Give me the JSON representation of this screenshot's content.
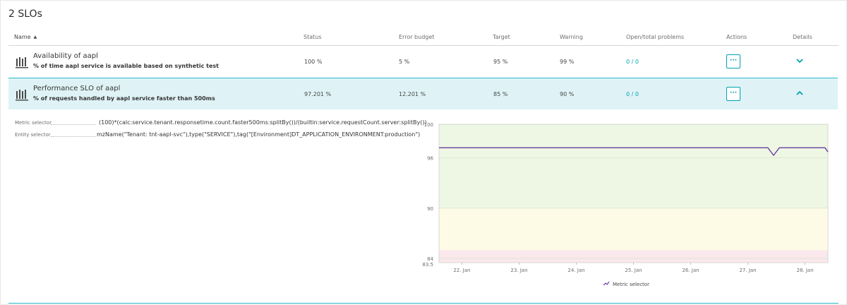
{
  "page": {
    "title": "2 SLOs"
  },
  "table": {
    "headers": {
      "name": "Name",
      "status": "Status",
      "error_budget": "Error budget",
      "target": "Target",
      "warning": "Warning",
      "problems": "Open/total problems",
      "actions": "Actions",
      "details": "Details"
    },
    "sort_icon": "sort-ascending-icon",
    "rows": [
      {
        "name": "Availability of aapl",
        "description": "% of time aapl service is available based on synthetic test",
        "status": "100 %",
        "error_budget": "5 %",
        "target": "95 %",
        "warning": "99 %",
        "problems": "0 / 0",
        "actions_label": "···",
        "expanded": false
      },
      {
        "name": "Performance SLO of aapl",
        "description": "% of requests handled by aapl service faster than 500ms",
        "status": "97.201 %",
        "error_budget": "12.201 %",
        "target": "85 %",
        "warning": "90 %",
        "problems": "0 / 0",
        "actions_label": "···",
        "expanded": true
      }
    ]
  },
  "details": {
    "metric_selector_label": "Metric selector",
    "metric_selector_value": "(100)*(calc:service.tenant.responsetime.count.faster500ms:splitBy())/(builtin:service.requestCount.server:splitBy())",
    "entity_selector_label": "Entity selector",
    "entity_selector_value": "mzName(\"Tenant: tnt-aapl-svc\"),type(\"SERVICE\"),tag(\"[Environment]DT_APPLICATION_ENVIRONMENT:production\")"
  },
  "colors": {
    "accent": "#00a1b2",
    "selected_row": "#dff3f6",
    "line": "#6b3fa0",
    "zone_good": "#eef6e4",
    "zone_warning": "#fdfbe5",
    "zone_bad": "#fbe8ec"
  },
  "chart_data": {
    "type": "line",
    "title": "",
    "xlabel": "",
    "ylabel": "",
    "xlim": [
      21.6,
      28.4
    ],
    "ylim": [
      83.5,
      100
    ],
    "y_ticks": [
      {
        "value": 100,
        "label": "100"
      },
      {
        "value": 96,
        "label": "96"
      },
      {
        "value": 90,
        "label": "90"
      },
      {
        "value": 84,
        "label": "84"
      },
      {
        "value": 83.5,
        "label": "83.5"
      }
    ],
    "x_ticks": [
      {
        "value": 22,
        "label": "22. Jan"
      },
      {
        "value": 23,
        "label": "23. Jan"
      },
      {
        "value": 24,
        "label": "24. Jan"
      },
      {
        "value": 25,
        "label": "25. Jan"
      },
      {
        "value": 26,
        "label": "26. Jan"
      },
      {
        "value": 27,
        "label": "27. Jan"
      },
      {
        "value": 28,
        "label": "28. Jan"
      }
    ],
    "zones": [
      {
        "from": 90,
        "to": 100,
        "color": "#eef6e4"
      },
      {
        "from": 85,
        "to": 90,
        "color": "#fdfbe5"
      },
      {
        "from": 83.5,
        "to": 85,
        "color": "#fbe8ec"
      }
    ],
    "series": [
      {
        "name": "Metric selector",
        "color": "#6b3fa0",
        "points": [
          [
            21.6,
            97.2
          ],
          [
            22.0,
            97.2
          ],
          [
            23.0,
            97.2
          ],
          [
            24.0,
            97.2
          ],
          [
            25.0,
            97.2
          ],
          [
            26.0,
            97.2
          ],
          [
            27.0,
            97.2
          ],
          [
            27.35,
            97.2
          ],
          [
            27.45,
            96.3
          ],
          [
            27.55,
            97.2
          ],
          [
            28.0,
            97.2
          ],
          [
            28.35,
            97.2
          ],
          [
            28.4,
            96.7
          ]
        ]
      }
    ],
    "legend": "bottom"
  }
}
